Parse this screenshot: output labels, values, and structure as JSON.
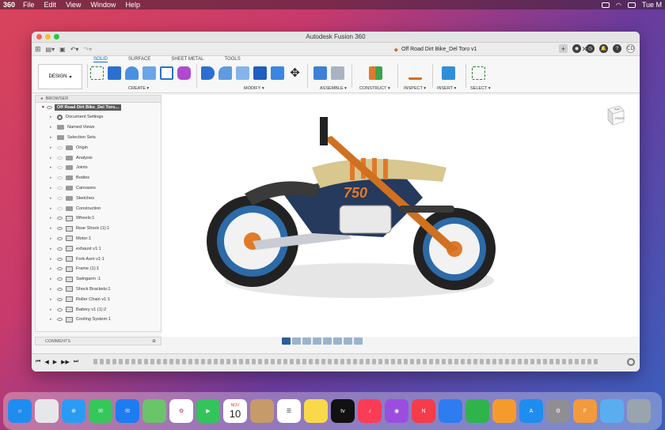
{
  "menubar": {
    "app": "360",
    "items": [
      "File",
      "Edit",
      "View",
      "Window",
      "Help"
    ],
    "clock": "Tue M"
  },
  "window": {
    "title": "Autodesk Fusion 360",
    "doc_tab": "Off Road Dirt Bike_Del Toro v1",
    "user_initials": "CD"
  },
  "ribbon": {
    "design_label": "DESIGN",
    "tabs": [
      "SOLID",
      "SURFACE",
      "SHEET METAL",
      "TOOLS"
    ],
    "groups": [
      "CREATE",
      "MODIFY",
      "ASSEMBLE",
      "CONSTRUCT",
      "INSPECT",
      "INSERT",
      "SELECT"
    ]
  },
  "browser": {
    "header": "BROWSER",
    "root": "Off Road Dirt Bike_Del Toro...",
    "items": [
      "Document Settings",
      "Named Views",
      "Selection Sets",
      "Origin",
      "Analysis",
      "Joints",
      "Bodies",
      "Canvases",
      "Sketches",
      "Construction",
      "Wheels:1",
      "Rear Shock (1):1",
      "Motor:1",
      "exhaust v1:1",
      "Fork Asm v1:1",
      "Frame (1):1",
      "Swingarm :1",
      "Shock Brackets:1",
      "Roller Chain v1:1",
      "Battery v1 (1):2",
      "Cooling System:1"
    ]
  },
  "comments": {
    "label": "COMMENTS"
  },
  "model": {
    "number_plate": "750"
  },
  "viewcube": {
    "top": "Right",
    "front": "FRONT"
  },
  "dock": {
    "calendar_month": "NOV",
    "calendar_day": "10",
    "tv_label": "tv"
  }
}
